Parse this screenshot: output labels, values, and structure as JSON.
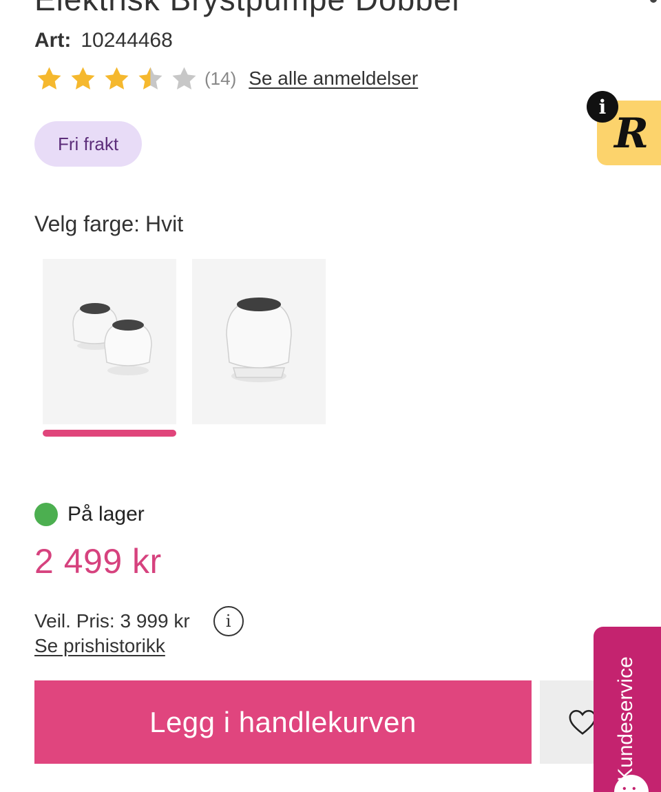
{
  "product": {
    "title": "Elektrisk Brystpumpe Dobbel",
    "article_label": "Art:",
    "article_number": "10244468",
    "rating": {
      "value": 3.5,
      "max": 5,
      "count_text": "(14)"
    },
    "reviews_link": "Se alle anmeldelser",
    "shipping_badge": "Fri frakt"
  },
  "reviews_widget": {
    "logo_letter": "R",
    "info_symbol": "i",
    "color": "#fcd36c"
  },
  "color_selector": {
    "label": "Velg farge:",
    "selected": "Hvit",
    "options": [
      {
        "image": "double-pump"
      },
      {
        "image": "single-pump"
      }
    ],
    "indicator_color": "#e0457b"
  },
  "availability": {
    "text": "På lager",
    "dot_color": "#4caf50"
  },
  "price": {
    "current": "2 499 kr",
    "color": "#d6427e"
  },
  "recommended_price": {
    "text": "Veil. Pris: 3 999 kr",
    "info_symbol": "i"
  },
  "price_history_link": "Se prishistorikk",
  "cart": {
    "add_label": "Legg i handlekurven",
    "button_color": "#e0457e",
    "wishlist_icon": "heart-icon"
  },
  "support": {
    "label": "Kundeservice",
    "bubble": "• •",
    "color": "#c4236f"
  }
}
